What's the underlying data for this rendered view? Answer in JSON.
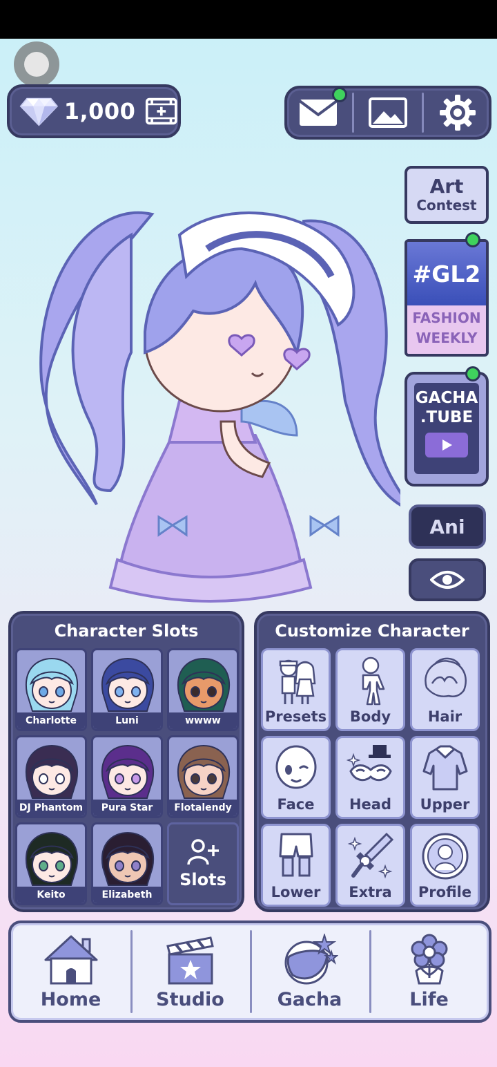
{
  "currency": {
    "amount": "1,000",
    "icon": "diamond-icon",
    "ad_icon": "video-plus-icon"
  },
  "top_bar": {
    "mail_icon": "mail-icon",
    "gallery_icon": "image-icon",
    "settings_icon": "gear-icon"
  },
  "side": {
    "art_contest": {
      "line1": "Art",
      "line2": "Contest"
    },
    "fashion": {
      "tag": "#GL2",
      "line1": "FASHION",
      "line2": "WEEKLY"
    },
    "gachatube": {
      "line1": "GACHA",
      "line2": ".TUBE"
    },
    "ani_label": "Ani",
    "eye_icon": "eye-icon"
  },
  "slots": {
    "title": "Character Slots",
    "items": [
      {
        "name": "Charlotte",
        "hair": "#9ad8ef",
        "skin": "#fde9e4",
        "eyes": "#6ea9e6"
      },
      {
        "name": "Luni",
        "hair": "#3b4aa0",
        "skin": "#fde9e4",
        "eyes": "#7fb2f0"
      },
      {
        "name": "wwww",
        "hair": "#1f5e52",
        "skin": "#e89a6a",
        "eyes": "#3a2b2b"
      },
      {
        "name": "DJ Phantom",
        "hair": "#3a2d52",
        "skin": "#fde9e4",
        "eyes": "#ffffff"
      },
      {
        "name": "Pura Star",
        "hair": "#5b2e8c",
        "skin": "#fde9e4",
        "eyes": "#c79ae8"
      },
      {
        "name": "Flotalendy",
        "hair": "#8a6250",
        "skin": "#f6d2c6",
        "eyes": "#4a3a3a"
      },
      {
        "name": "Keito",
        "hair": "#1e2a24",
        "skin": "#fde9e4",
        "eyes": "#5fae8a"
      },
      {
        "name": "Elizabeth",
        "hair": "#2a1e32",
        "skin": "#efc7b4",
        "eyes": "#8f80c8"
      }
    ],
    "add_label": "Slots",
    "add_icon": "add-user-icon"
  },
  "customize": {
    "title": "Customize Character",
    "items": [
      {
        "label": "Presets",
        "icon": "presets-icon"
      },
      {
        "label": "Body",
        "icon": "body-icon"
      },
      {
        "label": "Hair",
        "icon": "hair-icon"
      },
      {
        "label": "Face",
        "icon": "face-icon"
      },
      {
        "label": "Head",
        "icon": "head-icon"
      },
      {
        "label": "Upper",
        "icon": "shirt-icon"
      },
      {
        "label": "Lower",
        "icon": "pants-icon"
      },
      {
        "label": "Extra",
        "icon": "sword-icon"
      },
      {
        "label": "Profile",
        "icon": "profile-icon"
      }
    ]
  },
  "nav": [
    {
      "label": "Home",
      "icon": "house-icon"
    },
    {
      "label": "Studio",
      "icon": "clapperboard-icon"
    },
    {
      "label": "Gacha",
      "icon": "gacha-ball-icon"
    },
    {
      "label": "Life",
      "icon": "flower-icon"
    }
  ],
  "colors": {
    "panel": "#4a4e7c",
    "panel_border": "#363960",
    "notification": "#3fd25d"
  }
}
